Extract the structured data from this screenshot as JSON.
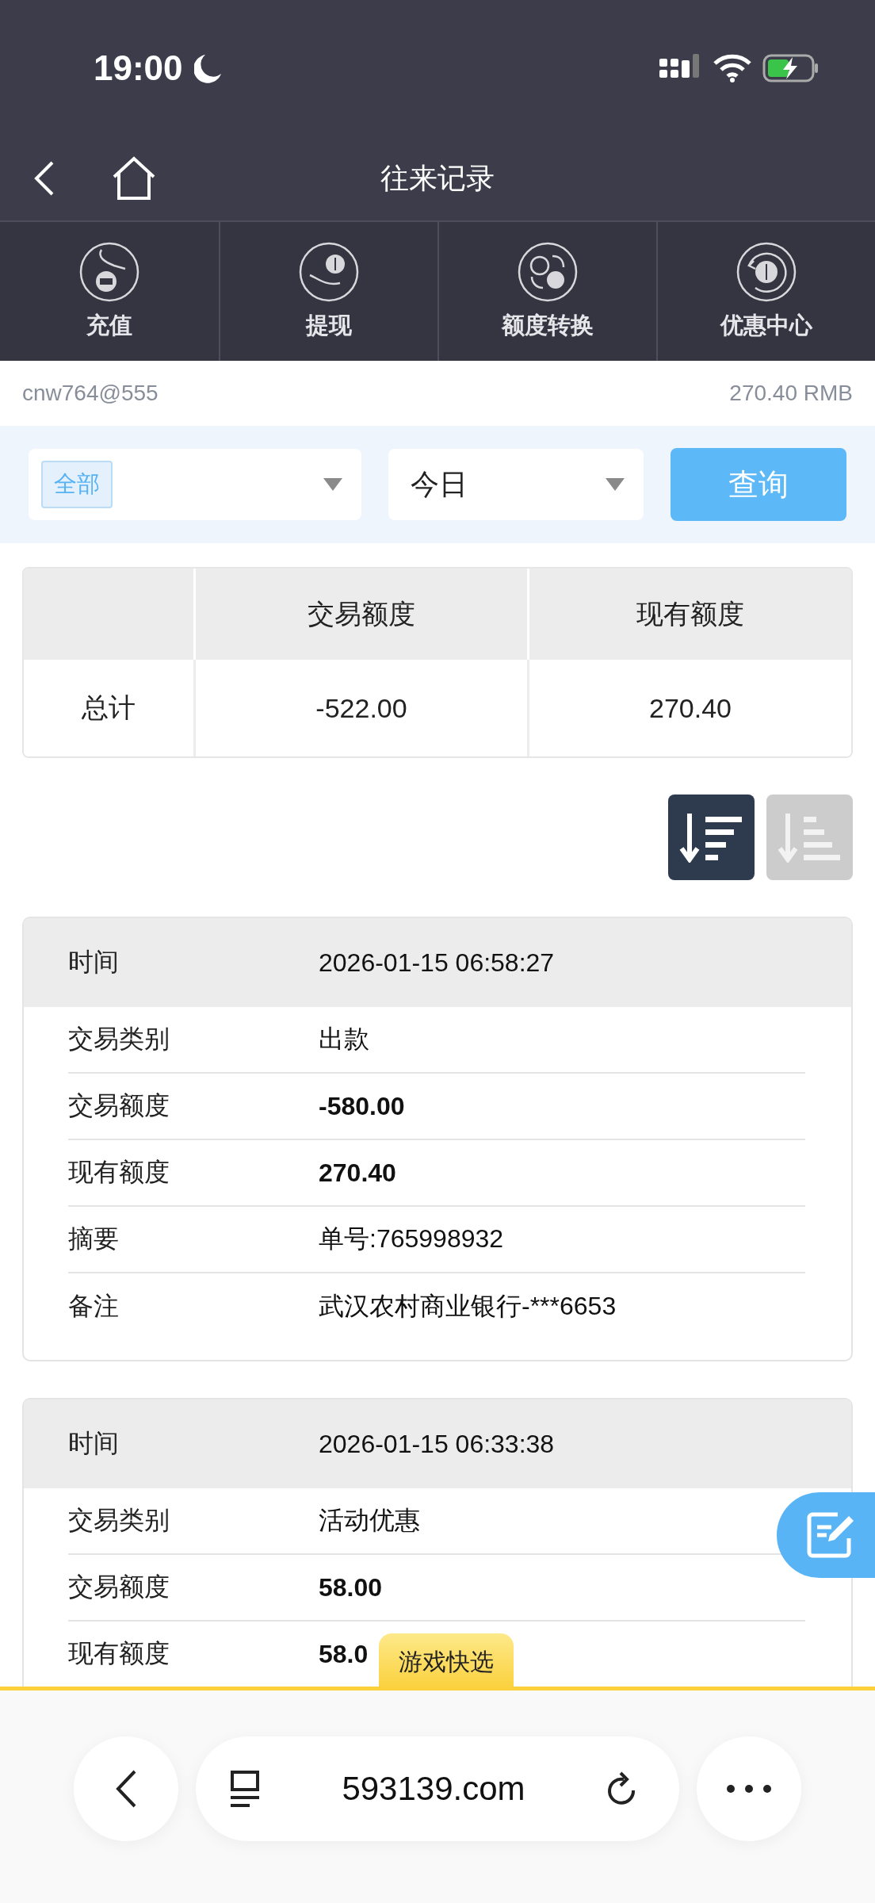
{
  "status_bar": {
    "time": "19:00"
  },
  "header": {
    "title": "往来记录"
  },
  "quick_actions": [
    {
      "label": "充值"
    },
    {
      "label": "提现"
    },
    {
      "label": "额度转换"
    },
    {
      "label": "优惠中心"
    }
  ],
  "account": {
    "username": "cnw764@555",
    "balance": "270.40 RMB"
  },
  "filters": {
    "type_tag": "全部",
    "period": "今日",
    "query_button": "查询"
  },
  "summary": {
    "columns": [
      "交易额度",
      "现有额度"
    ],
    "rows": [
      {
        "label": "总计",
        "cells": [
          "-522.00",
          "270.40"
        ]
      }
    ]
  },
  "sort_buttons": [
    {
      "selected": true
    },
    {
      "selected": false
    }
  ],
  "records": [
    {
      "header": {
        "label": "时间",
        "value": "2026-01-15 06:58:27"
      },
      "rows": [
        {
          "label": "交易类别",
          "value": "出款",
          "bold": false
        },
        {
          "label": "交易额度",
          "value": "-580.00",
          "bold": true
        },
        {
          "label": "现有额度",
          "value": "270.40",
          "bold": true
        },
        {
          "label": "摘要",
          "value": "单号:765998932",
          "bold": false
        },
        {
          "label": "备注",
          "value": "武汉农村商业银行-***6653",
          "bold": false
        }
      ]
    },
    {
      "header": {
        "label": "时间",
        "value": "2026-01-15 06:33:38"
      },
      "rows": [
        {
          "label": "交易类别",
          "value": "活动优惠",
          "bold": false
        },
        {
          "label": "交易额度",
          "value": "58.00",
          "bold": true
        },
        {
          "label": "现有额度",
          "value": "58.0",
          "bold": true
        }
      ]
    }
  ],
  "float_tab": "游戏快选",
  "browser_bar": {
    "url": "593139.com"
  }
}
